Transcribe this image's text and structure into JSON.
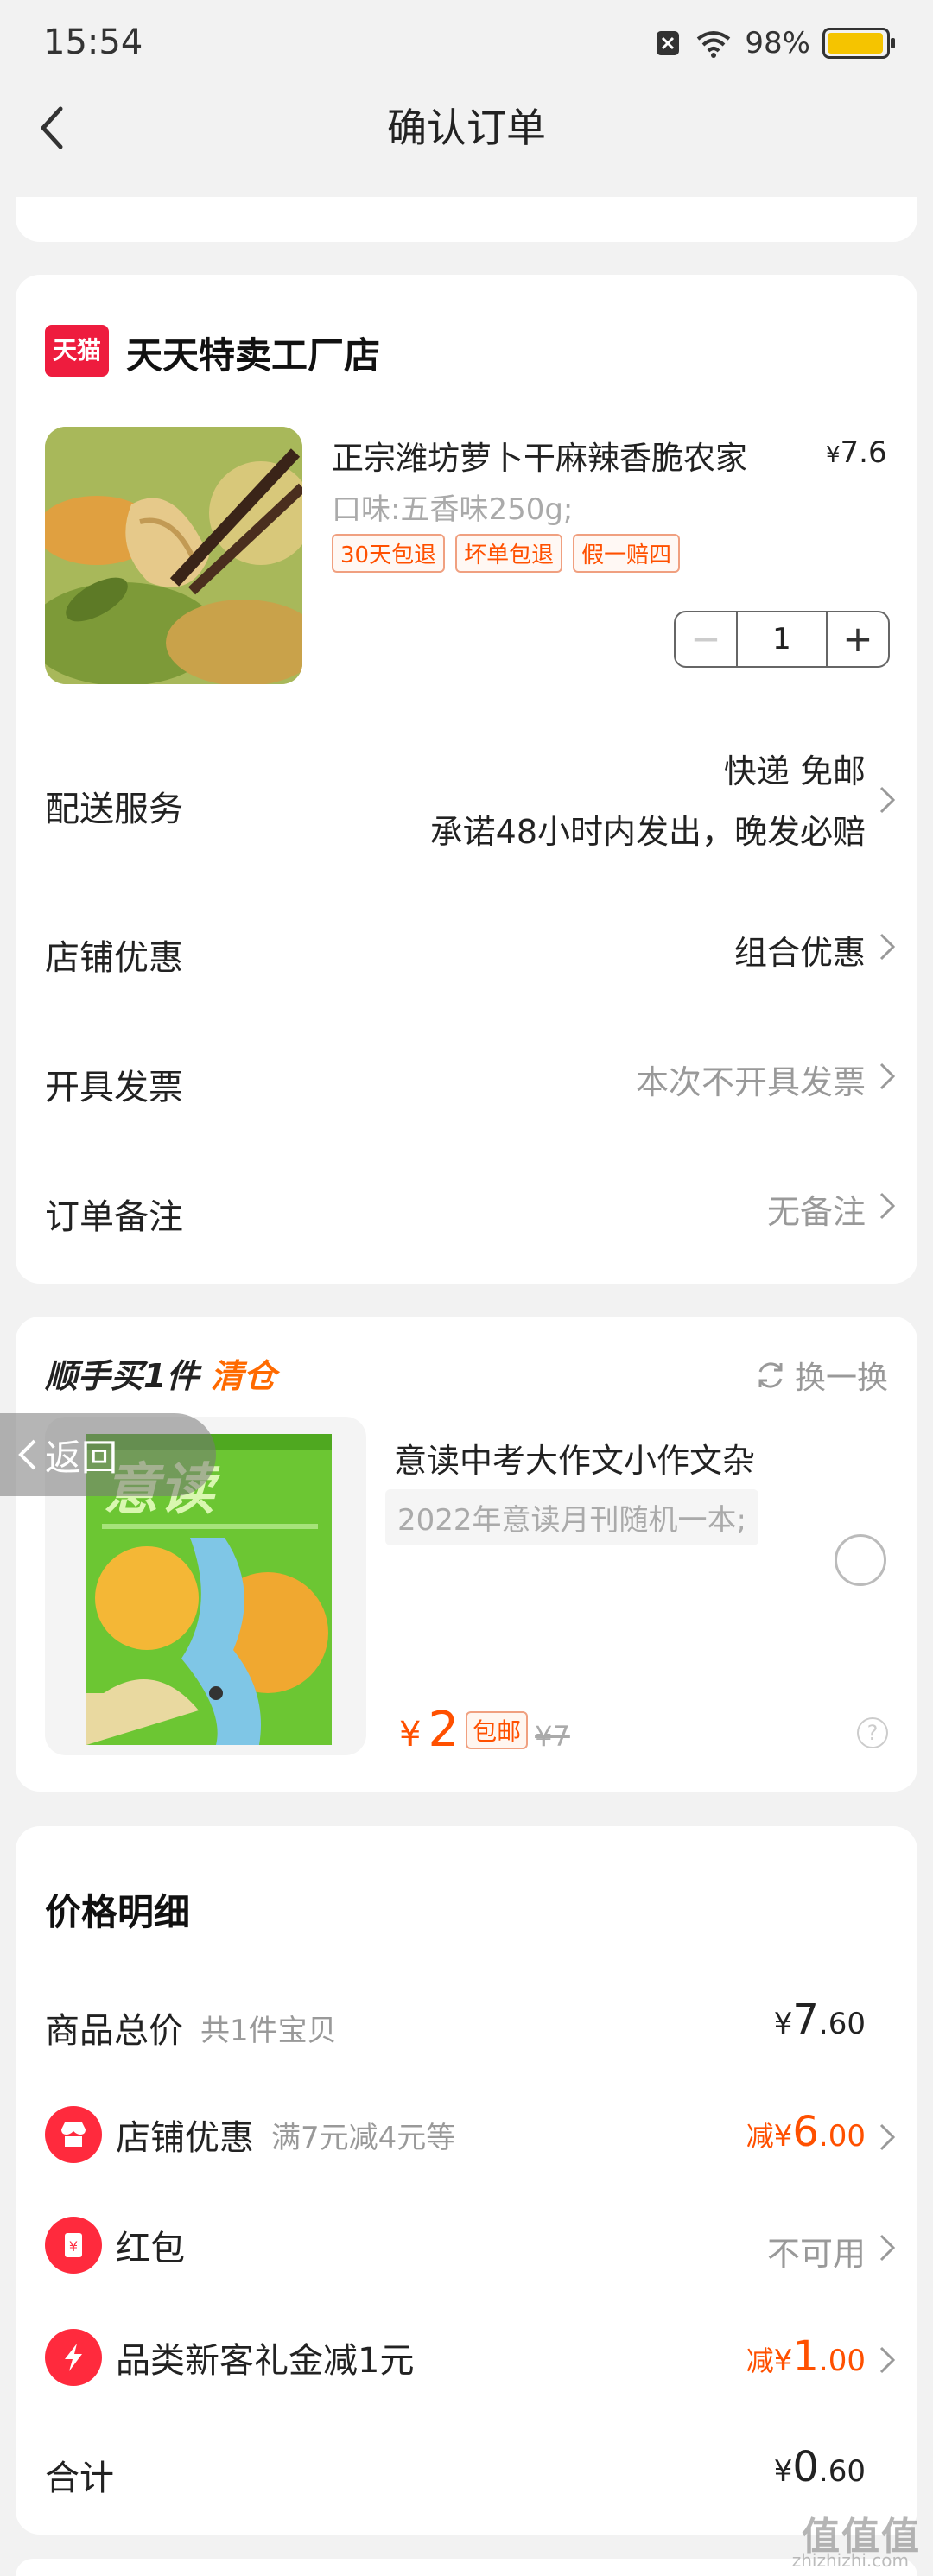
{
  "status_bar": {
    "time": "15:54",
    "battery_pct": "98%",
    "battery_level": 0.98
  },
  "nav": {
    "title": "确认订单"
  },
  "shop": {
    "badge": "天猫",
    "name": "天天特卖工厂店",
    "product": {
      "title": "正宗潍坊萝卜干麻辣香脆农家",
      "price_symbol": "¥",
      "price": "7.6",
      "spec": "口味:五香味250g;",
      "tags": [
        "30天包退",
        "坏单包退",
        "假一赔四"
      ],
      "quantity": "1",
      "minus": "−",
      "plus": "+"
    },
    "rows": {
      "delivery": {
        "label": "配送服务",
        "value1": "快递 免邮",
        "value2": "承诺48小时内发出，晚发必赔"
      },
      "discount": {
        "label": "店铺优惠",
        "value": "组合优惠"
      },
      "invoice": {
        "label": "开具发票",
        "value": "本次不开具发票"
      },
      "note": {
        "label": "订单备注",
        "value": "无备注"
      }
    }
  },
  "addon": {
    "title_prefix": "顺手买1件",
    "title_highlight": "清仓",
    "swap_label": "换一换",
    "back_label": "返回",
    "magazine_title": "意读",
    "name": "意读中考大作文小作文杂",
    "spec": "2022年意读月刊随机一本;",
    "price_symbol": "¥",
    "price": "2",
    "free_shipping": "包邮",
    "original_price": "¥7",
    "help": "?"
  },
  "price_detail": {
    "title": "价格明细",
    "total": {
      "label": "商品总价",
      "sub": "共1件宝贝",
      "symbol": "¥",
      "int": "7",
      "dec": ".60"
    },
    "shop_discount": {
      "label": "店铺优惠",
      "sub": "满7元减4元等",
      "prefix": "减",
      "symbol": "¥",
      "int": "6",
      "dec": ".00"
    },
    "red_packet": {
      "label": "红包",
      "value": "不可用"
    },
    "new_customer": {
      "label": "品类新客礼金减1元",
      "prefix": "减",
      "symbol": "¥",
      "int": "1",
      "dec": ".00"
    },
    "sum": {
      "label": "合计",
      "symbol": "¥",
      "int": "0",
      "dec": ".60"
    }
  },
  "watermark": {
    "main": "值值值",
    "sub": "zhizhizhi.com"
  },
  "colors": {
    "accent": "#ff5000",
    "tmall_red": "#ee1c3e",
    "battery": "#f5c400"
  }
}
